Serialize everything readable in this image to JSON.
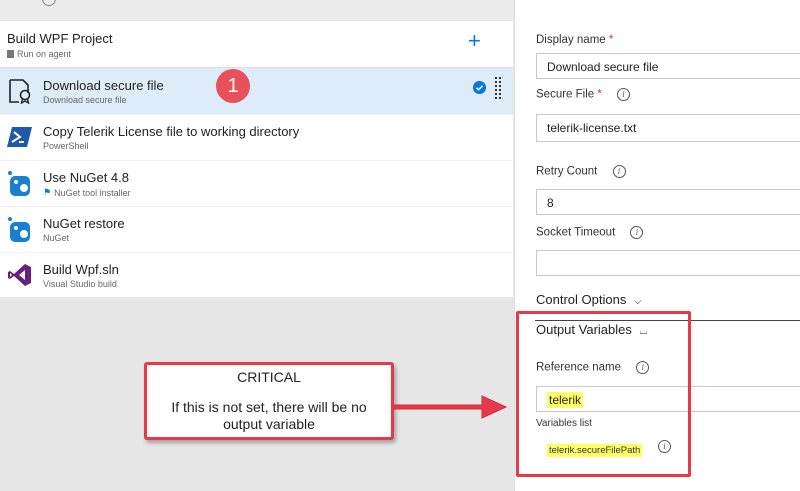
{
  "pipeline": {
    "phase": {
      "title": "Build WPF Project",
      "subtitle": "Run on agent"
    },
    "tasks": [
      {
        "name": "Download secure file",
        "subtitle": "Download secure file",
        "selected": true,
        "icon": "secure-file-icon"
      },
      {
        "name": "Copy Telerik License file to working directory",
        "subtitle": "PowerShell",
        "icon": "powershell-icon"
      },
      {
        "name": "Use NuGet 4.8",
        "subtitle": "NuGet tool installer",
        "icon": "nuget-icon"
      },
      {
        "name": "NuGet restore",
        "subtitle": "NuGet",
        "icon": "nuget-icon"
      },
      {
        "name": "Build Wpf.sln",
        "subtitle": "Visual Studio build",
        "icon": "visual-studio-icon"
      }
    ],
    "badge": "1"
  },
  "details": {
    "display_name_label": "Display name",
    "display_name_value": "Download secure file",
    "secure_file_label": "Secure File",
    "secure_file_value": "telerik-license.txt",
    "retry_count_label": "Retry Count",
    "retry_count_value": "8",
    "socket_timeout_label": "Socket Timeout",
    "socket_timeout_value": "",
    "control_options_label": "Control Options",
    "output_variables_label": "Output Variables",
    "reference_name_label": "Reference name",
    "reference_name_value": "telerik",
    "variables_list_label": "Variables list",
    "variables_list_value": "telerik.secureFilePath",
    "required_mark": "*"
  },
  "callout": {
    "title": "CRITICAL",
    "body": "If this is not set, there will be no output variable"
  },
  "colors": {
    "accent": "#0078d4",
    "selected": "#deecf9",
    "annotation": "#e6394a",
    "highlight": "#ffff66"
  }
}
